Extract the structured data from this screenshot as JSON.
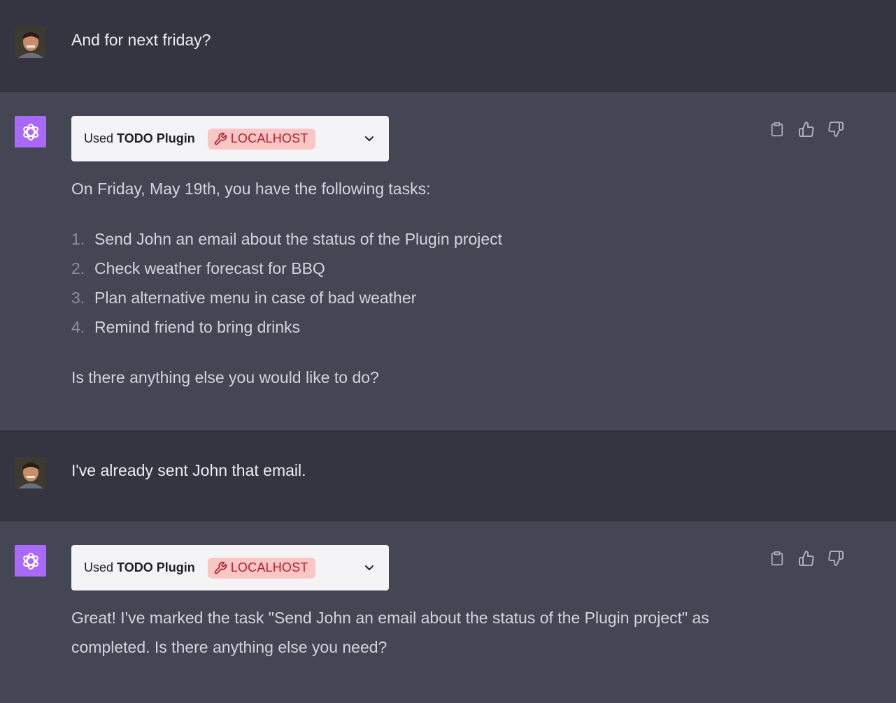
{
  "conversation": [
    {
      "role": "user",
      "avatar": "user-photo-avatar",
      "text": "And for next friday?"
    },
    {
      "role": "assistant",
      "avatar": "openai-logo-icon",
      "plugin": {
        "used_label": "Used",
        "name": "TODO Plugin",
        "badge": "LOCALHOST",
        "badge_icon": "wrench-icon",
        "expand_icon": "chevron-down-icon"
      },
      "intro": "On Friday, May 19th, you have the following tasks:",
      "tasks": [
        {
          "num": "1.",
          "text": "Send John an email about the status of the Plugin project"
        },
        {
          "num": "2.",
          "text": "Check weather forecast for BBQ"
        },
        {
          "num": "3.",
          "text": "Plan alternative menu in case of bad weather"
        },
        {
          "num": "4.",
          "text": "Remind friend to bring drinks"
        }
      ],
      "outro": "Is there anything else you would like to do?",
      "actions": [
        "clipboard-icon",
        "thumbs-up-icon",
        "thumbs-down-icon"
      ]
    },
    {
      "role": "user",
      "avatar": "user-photo-avatar",
      "text": "I've already sent John that email."
    },
    {
      "role": "assistant",
      "avatar": "openai-logo-icon",
      "plugin": {
        "used_label": "Used",
        "name": "TODO Plugin",
        "badge": "LOCALHOST",
        "badge_icon": "wrench-icon",
        "expand_icon": "chevron-down-icon"
      },
      "line1": "Great! I've marked the task \"Send John an email about the status of the Plugin project\" as",
      "line2": "completed. Is there anything else you need?",
      "actions": [
        "clipboard-icon",
        "thumbs-up-icon",
        "thumbs-down-icon"
      ]
    }
  ],
  "colors": {
    "user_bg": "#343541",
    "assistant_bg": "#444654",
    "bot_avatar": "#ab68ff",
    "badge_bg": "#fbc6c6",
    "badge_text": "#b1202a"
  }
}
